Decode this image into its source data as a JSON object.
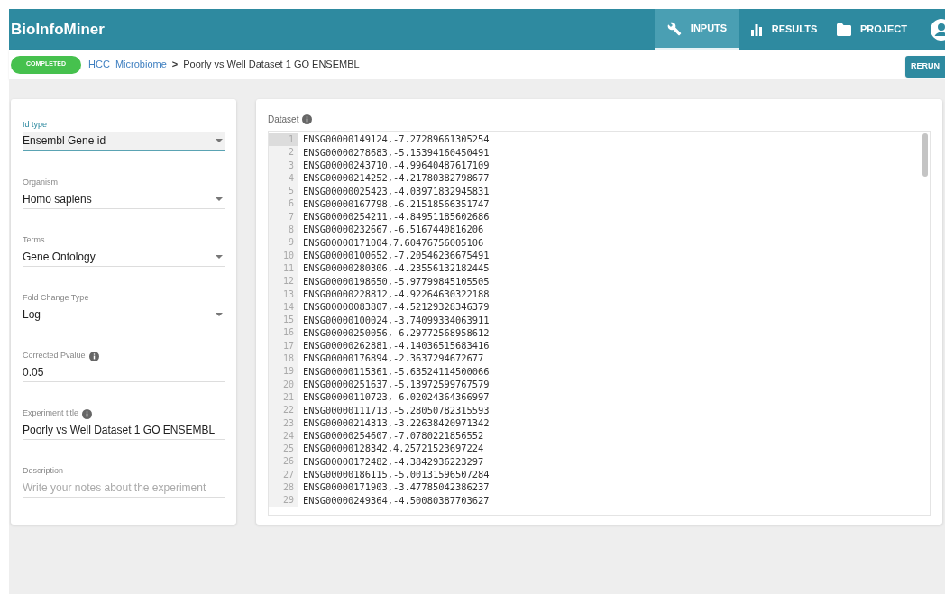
{
  "app": {
    "title": "BioInfoMiner"
  },
  "nav_tabs": [
    {
      "label": "INPUTS",
      "selected": true
    },
    {
      "label": "RESULTS",
      "selected": false
    },
    {
      "label": "PROJECT",
      "selected": false
    }
  ],
  "breadcrumb": {
    "status": "COMPLETED",
    "project": "HCC_Microbiome",
    "separator": ">",
    "experiment": "Poorly vs Well Dataset 1 GO ENSEMBL"
  },
  "rerun_button": "RERUN",
  "form_fields": [
    {
      "kind": "select",
      "label": "Id type",
      "value": "Ensembl Gene id",
      "focused": true,
      "info": false
    },
    {
      "kind": "select",
      "label": "Organism",
      "value": "Homo sapiens",
      "focused": false,
      "info": false
    },
    {
      "kind": "select",
      "label": "Terms",
      "value": "Gene Ontology",
      "focused": false,
      "info": false
    },
    {
      "kind": "select",
      "label": "Fold Change Type",
      "value": "Log",
      "focused": false,
      "info": false
    },
    {
      "kind": "text",
      "label": "Corrected Pvalue",
      "value": "0.05",
      "focused": false,
      "info": true
    },
    {
      "kind": "text",
      "label": "Experiment title",
      "value": "Poorly vs Well Dataset 1 GO ENSEMBL",
      "focused": false,
      "info": true
    },
    {
      "kind": "text",
      "label": "Description",
      "placeholder": "Write your notes about the experiment",
      "focused": false,
      "info": false
    }
  ],
  "dataset": {
    "label": "Dataset",
    "lines": [
      {
        "number": "1",
        "text": "ENSG00000149124,-7.27289661305254",
        "selected": true
      },
      {
        "number": "2",
        "text": "ENSG00000278683,-5.15394160450491",
        "selected": false
      },
      {
        "number": "3",
        "text": "ENSG00000243710,-4.99640487617109",
        "selected": false
      },
      {
        "number": "4",
        "text": "ENSG00000214252,-4.21780382798677",
        "selected": false
      },
      {
        "number": "5",
        "text": "ENSG00000025423,-4.03971832945831",
        "selected": false
      },
      {
        "number": "6",
        "text": "ENSG00000167798,-6.21518566351747",
        "selected": false
      },
      {
        "number": "7",
        "text": "ENSG00000254211,-4.84951185602686",
        "selected": false
      },
      {
        "number": "8",
        "text": "ENSG00000232667,-6.5167440816206",
        "selected": false
      },
      {
        "number": "9",
        "text": "ENSG00000171004,7.60476756005106",
        "selected": false
      },
      {
        "number": "10",
        "text": "ENSG00000100652,-7.20546236675491",
        "selected": false
      },
      {
        "number": "11",
        "text": "ENSG00000280306,-4.23556132182445",
        "selected": false
      },
      {
        "number": "12",
        "text": "ENSG00000198650,-5.97799845105505",
        "selected": false
      },
      {
        "number": "13",
        "text": "ENSG00000228812,-4.92264630322188",
        "selected": false
      },
      {
        "number": "14",
        "text": "ENSG00000083807,-4.52129328346379",
        "selected": false
      },
      {
        "number": "15",
        "text": "ENSG00000100024,-3.74099334063911",
        "selected": false
      },
      {
        "number": "16",
        "text": "ENSG00000250056,-6.29772568958612",
        "selected": false
      },
      {
        "number": "17",
        "text": "ENSG00000262881,-4.14036515683416",
        "selected": false
      },
      {
        "number": "18",
        "text": "ENSG00000176894,-2.3637294672677",
        "selected": false
      },
      {
        "number": "19",
        "text": "ENSG00000115361,-5.63524114500066",
        "selected": false
      },
      {
        "number": "20",
        "text": "ENSG00000251637,-5.13972599767579",
        "selected": false
      },
      {
        "number": "21",
        "text": "ENSG00000110723,-6.02024364366997",
        "selected": false
      },
      {
        "number": "22",
        "text": "ENSG00000111713,-5.28050782315593",
        "selected": false
      },
      {
        "number": "23",
        "text": "ENSG00000214313,-3.22638420971342",
        "selected": false
      },
      {
        "number": "24",
        "text": "ENSG00000254607,-7.0780221856552",
        "selected": false
      },
      {
        "number": "25",
        "text": "ENSG00000128342,4.25721523697224",
        "selected": false
      },
      {
        "number": "26",
        "text": "ENSG00000172482,-4.3842936223297",
        "selected": false
      },
      {
        "number": "27",
        "text": "ENSG00000186115,-5.00131596507284",
        "selected": false
      },
      {
        "number": "28",
        "text": "ENSG00000171903,-3.47785042386237",
        "selected": false
      },
      {
        "number": "29",
        "text": "ENSG00000249364,-4.50080387703627",
        "selected": false
      }
    ]
  }
}
